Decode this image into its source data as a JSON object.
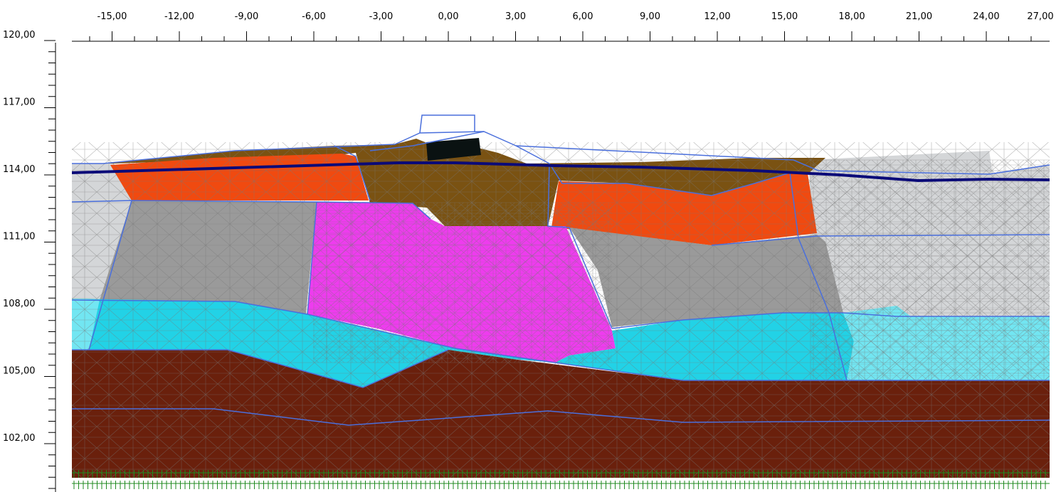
{
  "diagram": {
    "type": "geotechnical-cross-section",
    "x_axis": {
      "ticks": [
        -15,
        -12,
        -9,
        -6,
        -3,
        0,
        3,
        6,
        9,
        12,
        15,
        18,
        21,
        24,
        27
      ],
      "labels": [
        "-15,00",
        "-12,00",
        "-9,00",
        "-6,00",
        "-3,00",
        "0,00",
        "3,00",
        "6,00",
        "9,00",
        "12,00",
        "15,00",
        "18,00",
        "21,00",
        "24,00",
        "27,00"
      ]
    },
    "y_axis": {
      "ticks": [
        120,
        117,
        114,
        111,
        108,
        105,
        102
      ],
      "labels": [
        "120,00",
        "117,00",
        "114,00",
        "111,00",
        "108,00",
        "105,00",
        "102,00"
      ]
    },
    "colors": {
      "light_gray_fill": "#d4d6d8",
      "gray_fill": "#9a9a9a",
      "brown_fill": "#7a5212",
      "orange_fill": "#f04a10",
      "magenta_fill": "#ee3cee",
      "cyan_fill": "#22d2e6",
      "light_cyan_fill": "#72e6f2",
      "dark_brown_fill": "#6a200c",
      "foundation_black": "#0a1212",
      "water_table": "#0a0a78",
      "boundary_lines": "#4a6fdc",
      "fixity_green": "#1f8a1f"
    }
  }
}
